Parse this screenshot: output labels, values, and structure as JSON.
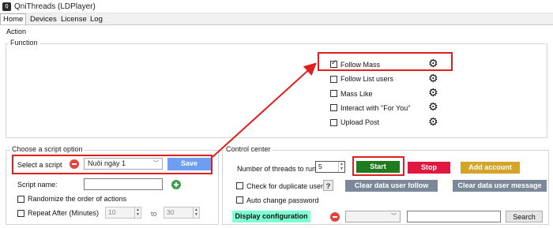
{
  "window": {
    "title": "QniThreads (LDPlayer)",
    "icon": "app-icon"
  },
  "tabs": [
    {
      "label": "Home",
      "active": true
    },
    {
      "label": "Devices",
      "active": false
    },
    {
      "label": "License",
      "active": false
    },
    {
      "label": "Log",
      "active": false
    }
  ],
  "action": {
    "title": "Action",
    "function": {
      "title": "Function",
      "items": [
        {
          "label": "Follow Mass",
          "checked": true
        },
        {
          "label": "Follow List users",
          "checked": false
        },
        {
          "label": "Mass Like",
          "checked": false
        },
        {
          "label": "Interact with \"For You\"",
          "checked": false
        },
        {
          "label": "Upload Post",
          "checked": false
        }
      ]
    }
  },
  "script_option": {
    "title": "Choose a script option",
    "select_label": "Select a script",
    "selected_script": "Nuôi ngày 1",
    "save_label": "Save",
    "name_label": "Script name:",
    "name_value": "",
    "randomize_label": "Randomize the order of actions",
    "randomize_checked": false,
    "repeat_label": "Repeat After (Minutes)",
    "repeat_checked": false,
    "repeat_from": "10",
    "repeat_to_label": "to",
    "repeat_to": "30"
  },
  "control_center": {
    "title": "Control center",
    "threads_label": "Number of threads to run:",
    "threads_value": "5",
    "start_label": "Start",
    "stop_label": "Stop",
    "add_account_label": "Add account",
    "duplicate_label": "Check for duplicate users",
    "duplicate_help": "?",
    "clear_follow_label": "Clear data user follow",
    "clear_message_label": "Clear data user message",
    "auto_password_label": "Auto change password",
    "display_config_label": "Display configuration",
    "config_select_value": "",
    "search_value": "",
    "search_label": "Search"
  },
  "colors": {
    "start": "#1e7b1e",
    "stop": "#e0173f",
    "add_account": "#d4a52b",
    "save": "#6d9eef",
    "clear": "#7a8899",
    "display_config": "#7fffd4",
    "highlight": "#e02020"
  }
}
